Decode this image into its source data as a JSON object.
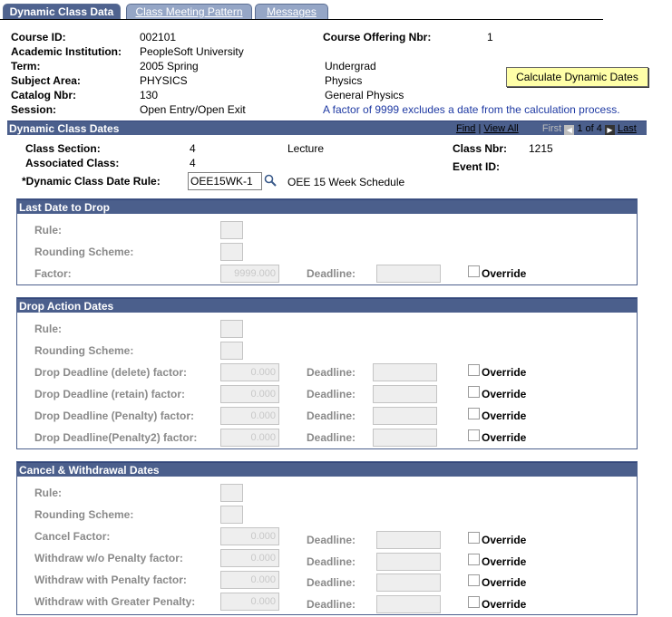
{
  "tabs": [
    {
      "label": "Dynamic Class Data"
    },
    {
      "label": "Class Meeting Pattern"
    },
    {
      "label": "Messages"
    }
  ],
  "info": {
    "course_id_label": "Course ID:",
    "course_id": "002101",
    "institution_label": "Academic Institution:",
    "institution": "PeopleSoft University",
    "term_label": "Term:",
    "term": "2005 Spring",
    "career": "Undergrad",
    "subject_label": "Subject Area:",
    "subject": "PHYSICS",
    "subject_desc": "Physics",
    "catalog_label": "Catalog Nbr:",
    "catalog": "130",
    "catalog_desc": "General Physics",
    "session_label": "Session:",
    "session": "Open Entry/Open Exit",
    "offering_label": "Course Offering Nbr:",
    "offering": "1",
    "note": "A factor of 9999 excludes a date from the calculation process.",
    "calc_button": "Calculate Dynamic Dates"
  },
  "dynamic": {
    "title": "Dynamic Class Dates",
    "find": "Find",
    "view_all": "View All",
    "first": "First",
    "pager": "1 of 4",
    "last": "Last",
    "section_label": "Class Section:",
    "section": "4",
    "component": "Lecture",
    "class_nbr_label": "Class Nbr:",
    "class_nbr": "1215",
    "assoc_label": "Associated Class:",
    "assoc": "4",
    "event_label": "Event ID:",
    "rule_label": "*Dynamic Class Date Rule:",
    "rule_value": "OEE15WK-1",
    "rule_desc": "OEE 15 Week Schedule"
  },
  "last_drop": {
    "title": "Last Date to Drop",
    "rule": "Rule:",
    "rounding": "Rounding Scheme:",
    "factor_label": "Factor:",
    "factor": "9999.000",
    "deadline": "Deadline:",
    "override": "Override"
  },
  "drop_action": {
    "title": "Drop Action Dates",
    "rule": "Rule:",
    "rounding": "Rounding Scheme:",
    "rows": [
      {
        "label": "Drop Deadline (delete) factor:",
        "value": "0.000"
      },
      {
        "label": "Drop Deadline (retain) factor:",
        "value": "0.000"
      },
      {
        "label": "Drop Deadline (Penalty) factor:",
        "value": "0.000"
      },
      {
        "label": "Drop Deadline(Penalty2) factor:",
        "value": "0.000"
      }
    ],
    "deadline": "Deadline:",
    "override": "Override"
  },
  "cancel": {
    "title": "Cancel & Withdrawal Dates",
    "rule": "Rule:",
    "rounding": "Rounding Scheme:",
    "rows": [
      {
        "label": "Cancel Factor:",
        "value": "0.000"
      },
      {
        "label": "Withdraw w/o Penalty factor:",
        "value": "0.000"
      },
      {
        "label": "Withdraw with Penalty factor:",
        "value": "0.000"
      },
      {
        "label": "Withdraw with Greater Penalty:",
        "value": "0.000"
      }
    ],
    "deadline": "Deadline:",
    "override": "Override"
  }
}
